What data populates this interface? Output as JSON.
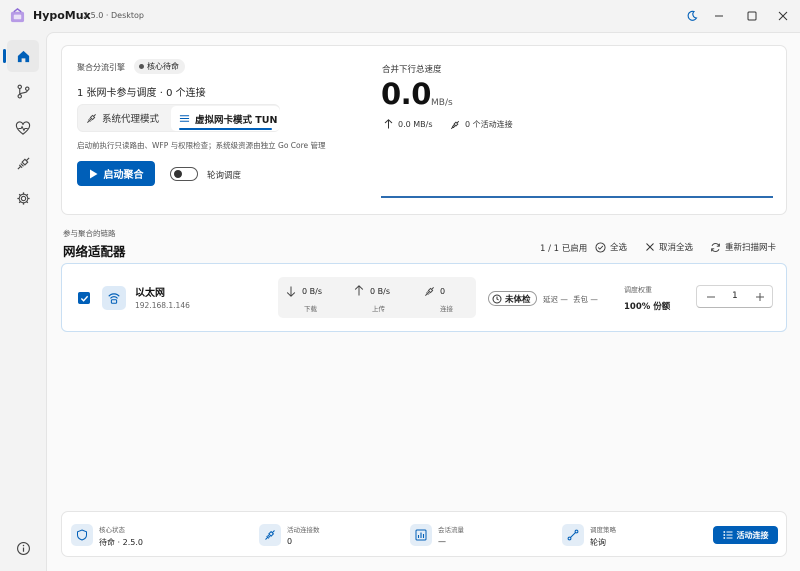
{
  "window": {
    "app_name": "HypoMux",
    "version": "2.5.0 · Desktop"
  },
  "nav": {
    "items": [
      "home-icon",
      "branch-icon",
      "heartbeat-icon",
      "plug-icon",
      "gear-icon",
      "info-icon"
    ],
    "active": "home"
  },
  "engine": {
    "label": "聚合分流引擎",
    "status": "核心待命",
    "summary": "1 张网卡参与调度 · 0 个连接",
    "modes": [
      {
        "label": "系统代理模式",
        "icon": "plug-icon"
      },
      {
        "label": "虚拟网卡模式 TUN",
        "icon": "menu-icon"
      }
    ],
    "active_mode": 1,
    "hint": "启动前执行只读路由、WFP 与权限检查；系统级资源由独立 Go Core 管理",
    "start_button": "启动聚合",
    "round_robin_label": "轮询调度",
    "round_robin_on": false
  },
  "speed": {
    "title": "合并下行总速度",
    "value": "0.0",
    "unit": "MB/s",
    "upload": "0.0 MB/s",
    "active_connections": "0 个活动连接"
  },
  "adapters": {
    "small_label": "参与聚合的链路",
    "title": "网络适配器",
    "enabled_count": "1 / 1 已启用",
    "select_all": "全选",
    "deselect_all": "取消全选",
    "rescan": "重新扫描网卡",
    "list": [
      {
        "checked": true,
        "name": "以太网",
        "ip": "192.168.1.146",
        "download": "0 B/s",
        "download_label": "下载",
        "upload": "0 B/s",
        "upload_label": "上传",
        "connections": "0",
        "connections_label": "连接",
        "health": "未体检",
        "latency": "延迟 —",
        "loss": "丢包 —",
        "weight_label": "调度权重",
        "weight_share": "100% 份额",
        "weight": "1"
      }
    ]
  },
  "footer": {
    "core_status_label": "核心状态",
    "core_status": "待命 · 2.5.0",
    "active_conn_label": "活动连接数",
    "active_conn": "0",
    "session_traffic_label": "会话流量",
    "session_traffic": "—",
    "policy_label": "调度策略",
    "policy": "轮询",
    "active_button": "活动连接"
  },
  "colors": {
    "accent": "#005fb8",
    "background": "#f3f3f3",
    "card": "#ffffff"
  }
}
